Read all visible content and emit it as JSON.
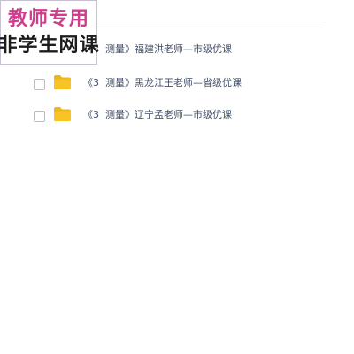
{
  "watermark": {
    "line1": "教师专用",
    "line2": "非学生网课"
  },
  "file_list": {
    "rows": [
      {
        "name": "《3  测量》福建洪老师—市级优课",
        "checked": false,
        "icon": "folder-icon"
      },
      {
        "name": "《3  测量》黑龙江王老师—省级优课",
        "checked": false,
        "icon": "folder-icon"
      },
      {
        "name": "《3  测量》辽宁孟老师—市级优课",
        "checked": false,
        "icon": "folder-icon"
      }
    ]
  },
  "colors": {
    "folder": "#f7c325",
    "folder_tab": "#f0b518",
    "watermark_accent": "#d23c8e",
    "text": "#424e67"
  }
}
